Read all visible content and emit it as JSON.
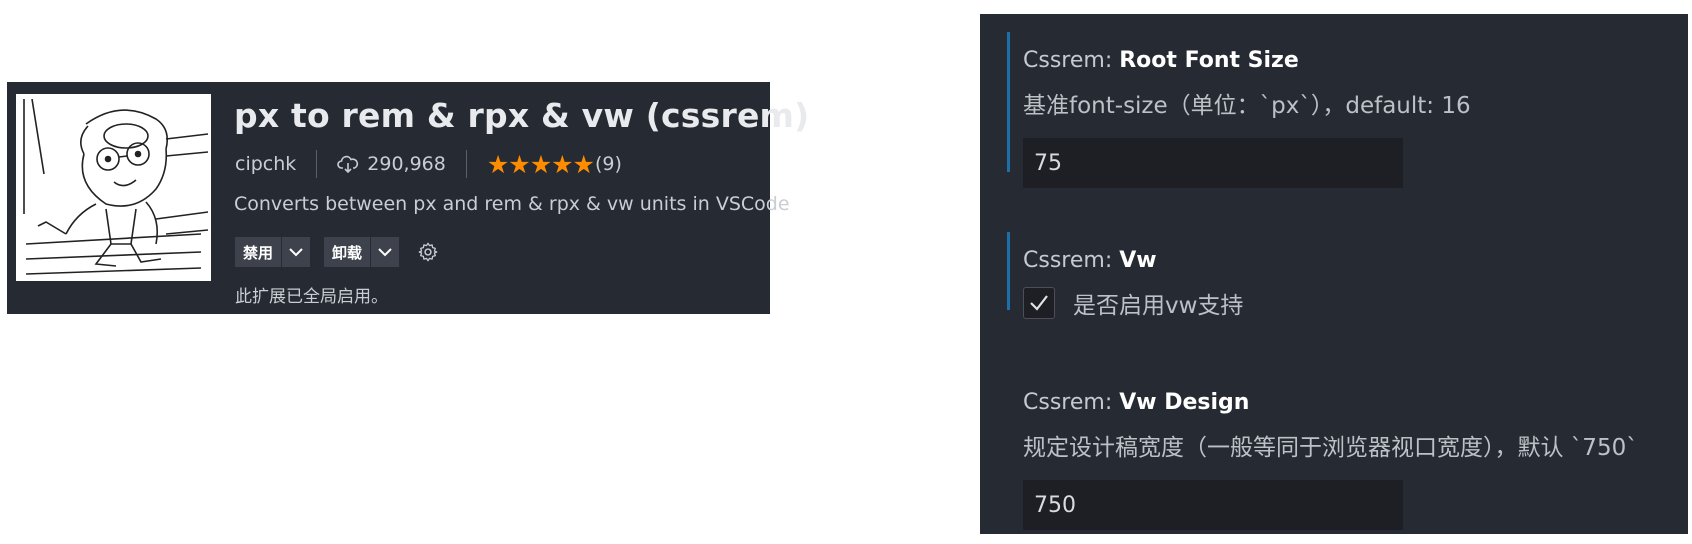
{
  "extension": {
    "title": "px to rem & rpx & vw (cssrem)",
    "publisher": "cipchk",
    "downloads": "290,968",
    "rating_stars": 5,
    "rating_count": "(9)",
    "description": "Converts between px and rem & rpx & vw units in VSCode",
    "disable_label": "禁用",
    "uninstall_label": "卸载",
    "status": "此扩展已全局启用。",
    "icons": {
      "download": "cloud-download-icon",
      "dropdown": "chevron-down-icon",
      "settings": "gear-icon",
      "star": "star-icon"
    },
    "colors": {
      "background": "#262a32",
      "star": "#ff8c00"
    }
  },
  "settings": {
    "root_font_size": {
      "prefix": "Cssrem: ",
      "name": "Root Font Size",
      "description": "基准font-size（单位：`px`），default: 16",
      "value": "75"
    },
    "vw": {
      "prefix": "Cssrem: ",
      "name": "Vw",
      "checkbox_label": "是否启用vw支持",
      "checked": true
    },
    "vw_design": {
      "prefix": "Cssrem: ",
      "name": "Vw Design",
      "description": "规定设计稿宽度（一般等同于浏览器视口宽度），默认 `750`",
      "value": "750"
    },
    "colors": {
      "background": "#262a32",
      "modified_bar": "#1e6ea7",
      "input_bg": "#1d1f24"
    }
  }
}
